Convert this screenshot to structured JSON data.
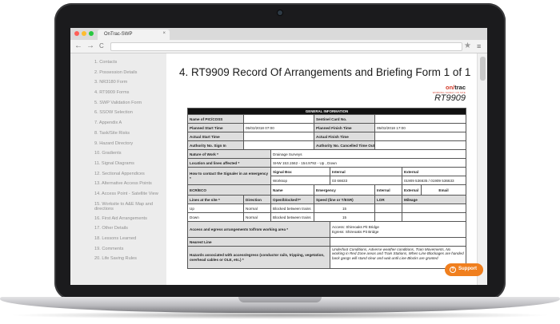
{
  "browser": {
    "tab_title": "OnTrac-SWP",
    "tab_close": "×",
    "back": "←",
    "forward": "→",
    "reload": "C",
    "star": "★",
    "menu": "≡",
    "traffic_colors": [
      "#ff5f57",
      "#febc2e",
      "#28c840"
    ]
  },
  "sidebar": {
    "items": [
      "1. Contacts",
      "2. Possession Details",
      "3. NR3180 Form",
      "4. RT9909 Forms",
      "5. SWP Validation Form",
      "6. SSOW Selection",
      "7. Appendix A",
      "8. Task/Site Risks",
      "9. Hazard Directory",
      "10. Gradients",
      "11. Signal Diagrams",
      "12. Sectional Appendices",
      "13. Alternative Access Points",
      "14. Access Point - Satellite View",
      "15. Worksite to A&E Map and directions",
      "16. First Aid Arrangements",
      "17. Other Details",
      "18. Lessons Learned",
      "19. Comments",
      "20. Life Saving Rules"
    ]
  },
  "page": {
    "title": "4. RT9909 Record Of Arrangements and Briefing Form 1 of 1",
    "logo_prefix": "on/",
    "logo_suffix": "trac",
    "logo_sub": "WORKING SAFELY ON SITE",
    "logo_form": "RT9909"
  },
  "form": {
    "general_info": "GENERAL INFORMATION",
    "name_pic_label": "Name of PIC/COSS",
    "sentinel_label": "Sentinel Card No.",
    "planned_start_label": "Planned Start Time",
    "planned_start_value": "05/02/2018 07:00",
    "planned_finish_label": "Planned Finish Time",
    "planned_finish_value": "05/02/2018 17:00",
    "actual_start_label": "Actual Start Time",
    "actual_finish_label": "Actual Finish Time",
    "authority_label": "Authority No. Sign In",
    "authority_cancel_label": "Authority No. Cancelled Time Out",
    "nature_label": "Nature of Work *",
    "nature_value": "Drainage Surveys",
    "location_label": "Location and lines affected *",
    "location_value": "SHW 153.1562 - 154.9792 - Up , Down",
    "signaller_label": "How to contact the Signaler in an emergency *",
    "signal_box_label": "Signal Box",
    "internal_label": "Internal",
    "external_label": "External",
    "signal_box_value": "Worksop",
    "internal_value": "03 66633",
    "external_value": "01909 536635 / 01909 536633",
    "ecr_label": "ECR/ECO",
    "ecr_name": "Name",
    "ecr_emergency": "Emergency",
    "ecr_internal": "Internal",
    "ecr_external": "External",
    "ecr_email": "Email",
    "lines_header": "Lines at the site *",
    "direction_header": "Direction",
    "open_blocked_header": "Open/blocked?*",
    "speed_header": "Speed (line or T/ESR)",
    "lor_header": "LOR",
    "mileage_header": "Mileage",
    "rows": [
      {
        "line": "Up",
        "direction": "Normal",
        "status": "Blocked between trains",
        "speed": "15"
      },
      {
        "line": "Down",
        "direction": "Normal",
        "status": "Blocked between trains",
        "speed": "15"
      }
    ],
    "access_label": "Access and egress arrangements to/from working area *",
    "access_value": "Access:   Shireoaks Pit Bridge",
    "egress_value": "Egress:   Shireoaks Pit Bridge",
    "nearest_line_label": "Nearest Line",
    "hazards_label": "Hazards associated with access/egress (conductor rails, tripping, vegetation, overhead cables or OLE, etc.) *",
    "hazards_value": "Underfoot Conditions, Adverse weather conditions, Train Movements, No working in Red Zone areas and Train Stations, When Line Blockages are handed back gangs will stand clear and wait until Line Blocks are granted"
  },
  "support": {
    "label": "Support",
    "icon": "?"
  },
  "colors": {
    "support": "#f07f1e",
    "header": "#111111",
    "label_bg": "#dedede",
    "logo_accent": "#d23b2a"
  }
}
